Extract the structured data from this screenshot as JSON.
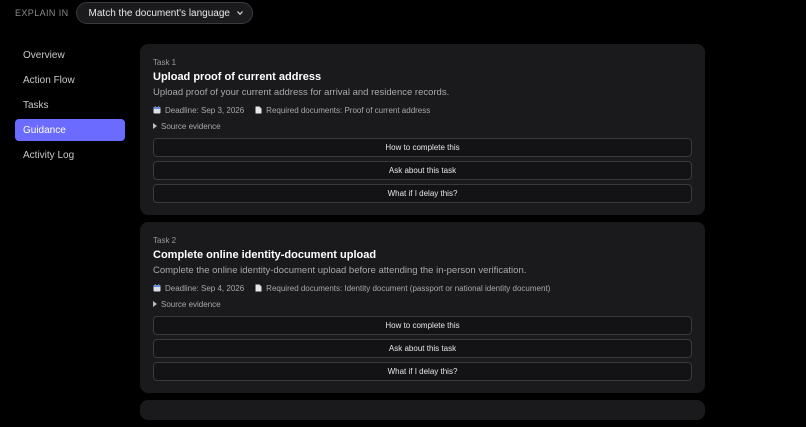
{
  "header": {
    "explain_label": "EXPLAIN IN",
    "language_select": "Match the document's language"
  },
  "sidebar": {
    "items": [
      {
        "label": "Overview"
      },
      {
        "label": "Action Flow"
      },
      {
        "label": "Tasks"
      },
      {
        "label": "Guidance"
      },
      {
        "label": "Activity Log"
      }
    ],
    "active_index": 3
  },
  "tasks": [
    {
      "number": "Task 1",
      "title": "Upload proof of current address",
      "description": "Upload proof of your current address for arrival and residence records.",
      "deadline": "Deadline: Sep 3, 2026",
      "required_docs": "Required documents: Proof of current address",
      "source_evidence": "Source evidence",
      "actions": [
        "How to complete this",
        "Ask about this task",
        "What if I delay this?"
      ]
    },
    {
      "number": "Task 2",
      "title": "Complete online identity-document upload",
      "description": "Complete the online identity-document upload before attending the in-person verification.",
      "deadline": "Deadline: Sep 4, 2026",
      "required_docs": "Required documents: Identity document (passport or national identity document)",
      "source_evidence": "Source evidence",
      "actions": [
        "How to complete this",
        "Ask about this task",
        "What if I delay this?"
      ]
    }
  ],
  "colors": {
    "background": "#000000",
    "card": "#1a1a1d",
    "accent": "#6b6cff"
  },
  "icons": {
    "calendar": "calendar-icon",
    "document": "document-icon",
    "disclosure": "disclosure-triangle-icon",
    "select_chevron": "chevron-down-icon"
  }
}
